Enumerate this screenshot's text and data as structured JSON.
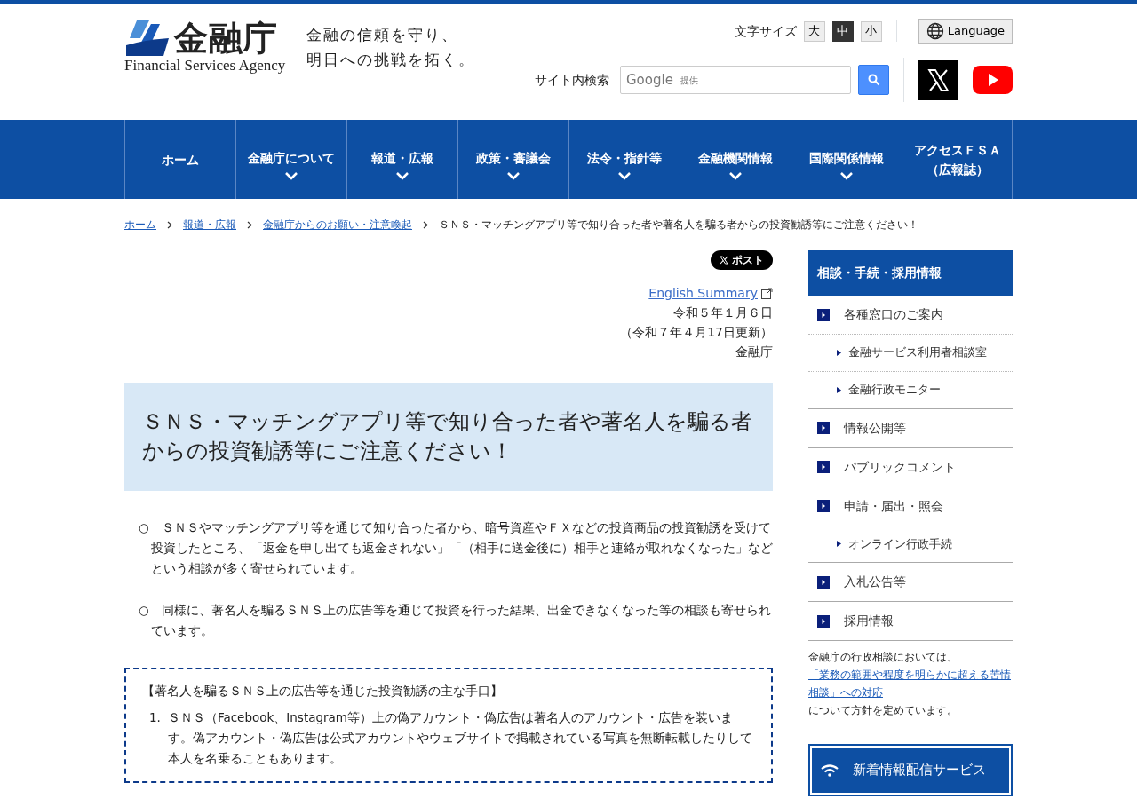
{
  "header": {
    "logo_title": "金融庁",
    "logo_subtitle": "Financial Services Agency",
    "slogan": [
      "金融の信頼を守り、",
      "明日への挑戦を拓く。"
    ],
    "font_size": {
      "label": "文字サイズ",
      "options": [
        {
          "label": "大",
          "selected": false
        },
        {
          "label": "中",
          "selected": true
        },
        {
          "label": "小",
          "selected": false
        }
      ]
    },
    "language_button": "Language",
    "search": {
      "label": "サイト内検索",
      "placeholder_brand": "Google",
      "placeholder": "提供"
    }
  },
  "nav": [
    {
      "lines": [
        "ホーム"
      ],
      "expandable": false
    },
    {
      "lines": [
        "金融庁について"
      ],
      "expandable": true
    },
    {
      "lines": [
        "報道・広報"
      ],
      "expandable": true
    },
    {
      "lines": [
        "政策・審議会"
      ],
      "expandable": true
    },
    {
      "lines": [
        "法令・指針等"
      ],
      "expandable": true
    },
    {
      "lines": [
        "金融機関情報"
      ],
      "expandable": true
    },
    {
      "lines": [
        "国際関係情報"
      ],
      "expandable": true
    },
    {
      "lines": [
        "アクセスＦＳＡ",
        "（広報誌）"
      ],
      "expandable": false
    }
  ],
  "breadcrumb": {
    "links": [
      "ホーム",
      "報道・広報",
      "金融庁からのお願い・注意喚起"
    ],
    "current": "ＳＮＳ・マッチングアプリ等で知り合った者や著名人を騙る者からの投資勧誘等にご注意ください！"
  },
  "article": {
    "post_button": "ポスト",
    "english_summary": "English Summary",
    "date": "令和５年１月６日",
    "updated": "（令和７年４月17日更新）",
    "author": "金融庁",
    "title": "ＳＮＳ・マッチングアプリ等で知り合った者や著名人を騙る者からの投資勧誘等にご注意ください！",
    "paragraphs": [
      "○　ＳＮＳやマッチングアプリ等を通じて知り合った者から、暗号資産やＦＸなどの投資商品の投資勧誘を受けて投資したところ、「返金を申し出ても返金されない」「（相手に送金後に）相手と連絡が取れなくなった」などという相談が多く寄せられています。",
      "○　同様に、著名人を騙るＳＮＳ上の広告等を通じて投資を行った結果、出金できなくなった等の相談も寄せられています。"
    ],
    "box": {
      "heading": "【著名人を騙るＳＮＳ上の広告等を通じた投資勧誘の主な手口】",
      "items": [
        {
          "number": "1.",
          "text": "ＳＮＳ（Facebook、Instagram等）上の偽アカウント・偽広告は著名人のアカウント・広告を装います。偽アカウント・偽広告は公式アカウントやウェブサイトで掲載されている写真を無断転載したりして本人を名乗ることもあります。"
        }
      ]
    }
  },
  "sidebar": {
    "heading": "相談・手続・採用情報",
    "items": [
      {
        "kind": "main",
        "label": "各種窓口のご案内"
      },
      {
        "kind": "sub",
        "label": "金融サービス利用者相談室"
      },
      {
        "kind": "sub",
        "label": "金融行政モニター"
      },
      {
        "kind": "main",
        "label": "情報公開等"
      },
      {
        "kind": "main",
        "label": "パブリックコメント"
      },
      {
        "kind": "main",
        "label": "申請・届出・照会"
      },
      {
        "kind": "sub",
        "label": "オンライン行政手続"
      },
      {
        "kind": "main",
        "label": "入札公告等"
      },
      {
        "kind": "main",
        "label": "採用情報"
      }
    ],
    "note": {
      "before": "金融庁の行政相談においては、",
      "link": "「業務の範囲や程度を明らかに超える苦情相談」への対応",
      "after": "について方針を定めています。"
    },
    "banner": "新着情報配信サービス"
  }
}
